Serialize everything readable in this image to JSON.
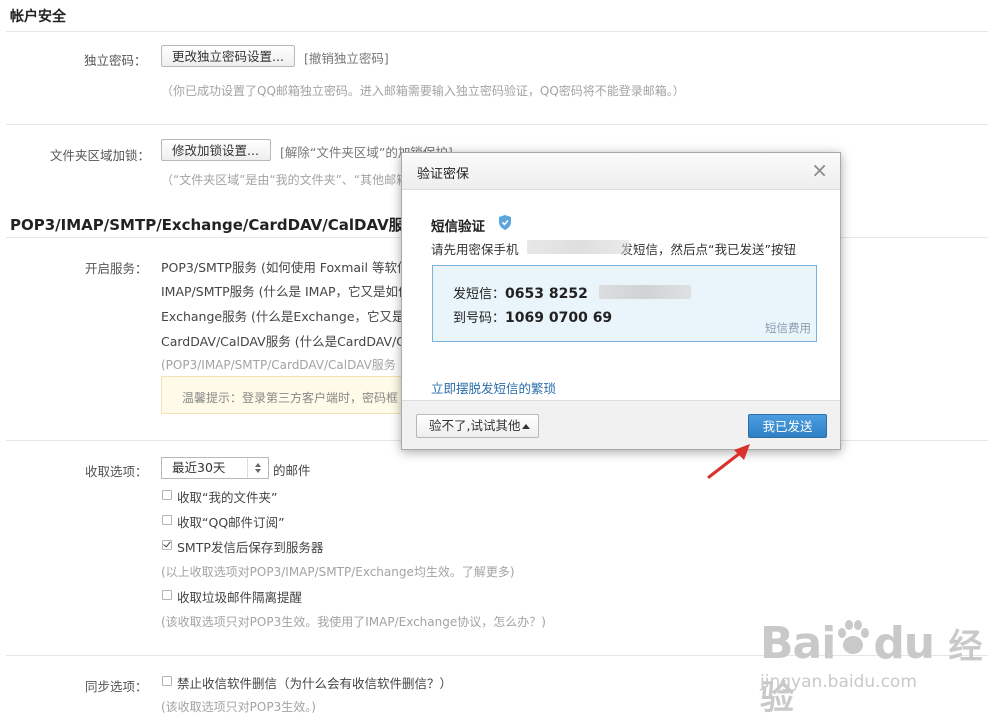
{
  "account_security": {
    "title": "帐户安全",
    "independent_password": {
      "label": "独立密码：",
      "button": "更改独立密码设置...",
      "revoke_link": "[撤销独立密码]",
      "hint": "（你已成功设置了QQ邮箱独立密码。进入邮箱需要输入独立密码验证，QQ密码将不能登录邮箱。）"
    },
    "folder_lock": {
      "label": "文件夹区域加锁：",
      "button": "修改加锁设置...",
      "remove_link": "[解除“文件夹区域”的加锁保护]",
      "hint": "（“文件夹区域”是由“我的文件夹”、“其他邮箱"
    }
  },
  "pop3_section": {
    "title": "POP3/IMAP/SMTP/Exchange/CardDAV/CalDAV服",
    "enable_label": "开启服务：",
    "services": [
      "POP3/SMTP服务 (如何使用 Foxmail 等软件",
      "IMAP/SMTP服务 (什么是 IMAP，它又是如何",
      "Exchange服务 (什么是Exchange，它又是",
      "CardDAV/CalDAV服务 (什么是CardDAV/C"
    ],
    "services_hint": "(POP3/IMAP/SMTP/CardDAV/CalDAV服务",
    "notice": "温馨提示：登录第三方客户端时，密码框"
  },
  "receive_options": {
    "label": "收取选项：",
    "range_select": "最近30天",
    "range_suffix": "的邮件",
    "checkboxes": [
      {
        "label": "收取“我的文件夹”",
        "checked": false
      },
      {
        "label": "收取“QQ邮件订阅”",
        "checked": false
      },
      {
        "label": "SMTP发信后保存到服务器",
        "checked": true
      }
    ],
    "hint1": "(以上收取选项对POP3/IMAP/SMTP/Exchange均生效。了解更多)",
    "spam_checkbox": {
      "label": "收取垃圾邮件隔离提醒",
      "checked": false
    },
    "hint2": "(该收取选项只对POP3生效。我使用了IMAP/Exchange协议，怎么办？)"
  },
  "sync_options": {
    "label": "同步选项：",
    "checkbox": {
      "label": "禁止收信软件删信（为什么会有收信软件删信？）",
      "checked": false
    },
    "hint": "(该收取选项只对POP3生效。)"
  },
  "modal": {
    "title": "验证密保",
    "close": "×",
    "heading": "短信验证",
    "instruction_prefix": "请先用密保手机",
    "instruction_suffix": "发短信，然后点“我已发送”按钮",
    "send_label": "发短信：",
    "send_number": "0653 8252",
    "to_label": "到号码：",
    "to_number": "1069 0700 69",
    "fee_link": "短信费用",
    "escape_link": "立即摆脱发短信的繁琐",
    "other_button": "验不了,试试其他",
    "sent_button": "我已发送"
  },
  "watermark": {
    "brand": "Bai",
    "brand2": "du",
    "jingyan": "经验",
    "url": "jingyan.baidu.com"
  },
  "colors": {
    "primary_button": "#2f7fc4",
    "sms_box_bg": "#e9f4fb",
    "arrow": "#d9312b"
  }
}
